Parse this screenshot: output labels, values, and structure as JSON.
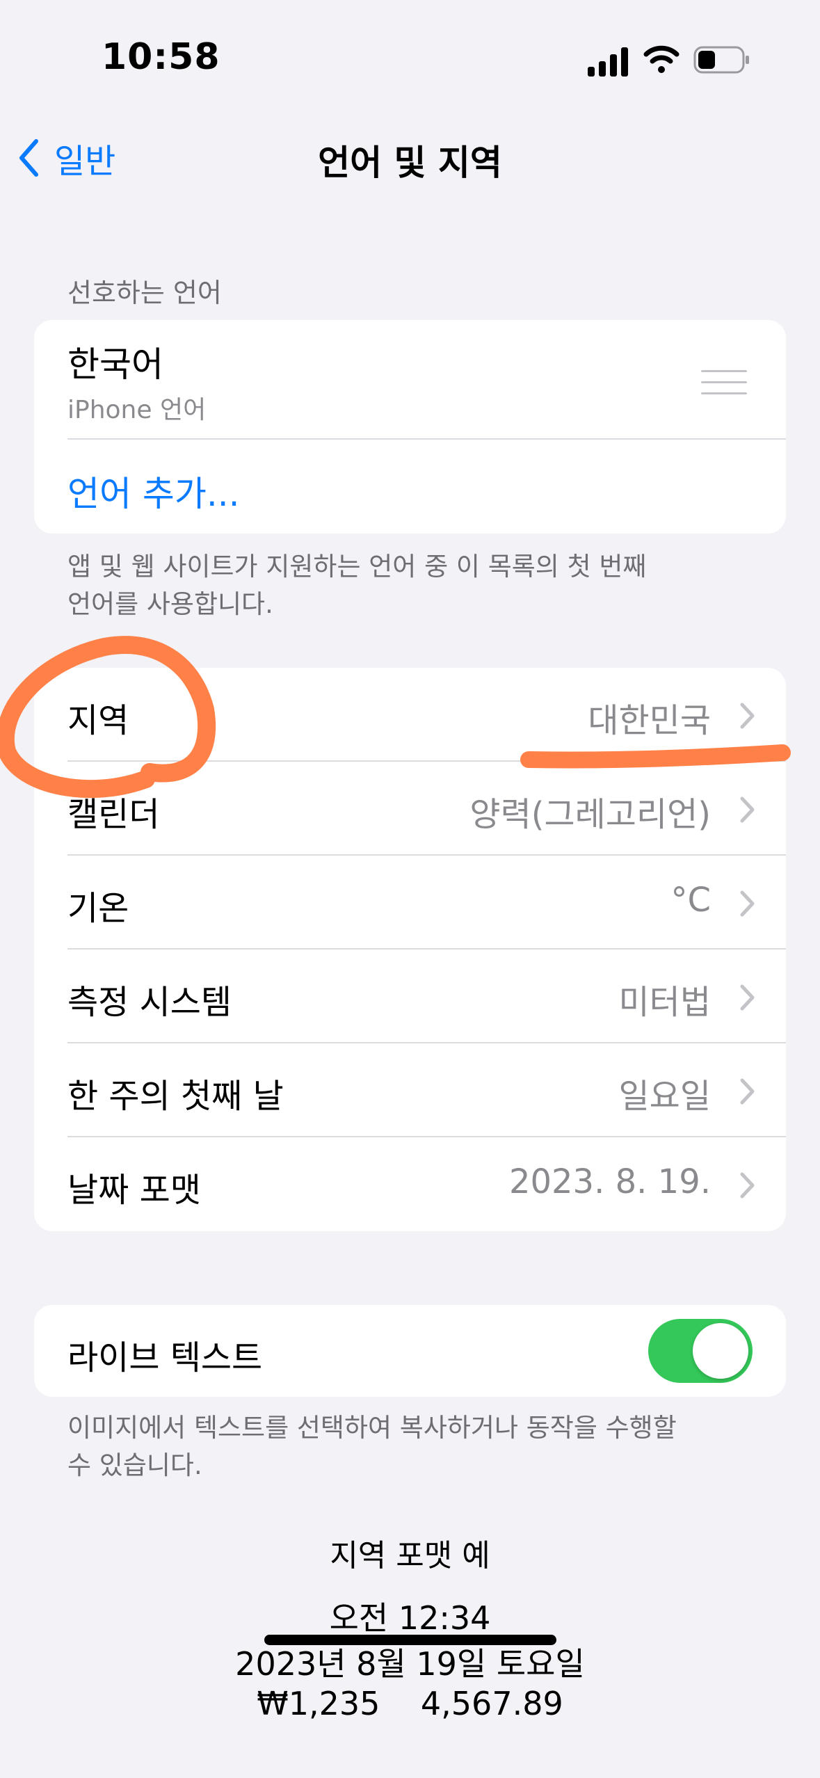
{
  "status_bar": {
    "time": "10:58"
  },
  "nav": {
    "back_label": "일반",
    "title": "언어 및 지역"
  },
  "preferred_languages": {
    "header": "선호하는 언어",
    "language_name": "한국어",
    "language_sub": "iPhone 언어",
    "add_label": "언어 추가...",
    "footer_line1": "앱 및 웹 사이트가 지원하는 언어 중 이 목록의 첫 번째",
    "footer_line2": "언어를 사용합니다."
  },
  "region_settings": [
    {
      "label": "지역",
      "value": "대한민국"
    },
    {
      "label": "캘린더",
      "value": "양력(그레고리언)"
    },
    {
      "label": "기온",
      "value": "°C"
    },
    {
      "label": "측정 시스템",
      "value": "미터법"
    },
    {
      "label": "한 주의 첫째 날",
      "value": "일요일"
    },
    {
      "label": "날짜 포맷",
      "value": "2023. 8. 19."
    }
  ],
  "live_text": {
    "label": "라이브 텍스트",
    "enabled": true,
    "footer_line1": "이미지에서 텍스트를 선택하여 복사하거나 동작을 수행할",
    "footer_line2": "수 있습니다."
  },
  "format_example": {
    "title": "지역 포맷 예",
    "time": "오전 12:34",
    "date": "2023년 8월 19일 토요일",
    "numbers": "₩1,235    4,567.89"
  },
  "colors": {
    "accent": "#0a7aff",
    "toggle_on": "#34c759",
    "annotation": "#ff7a3d"
  }
}
